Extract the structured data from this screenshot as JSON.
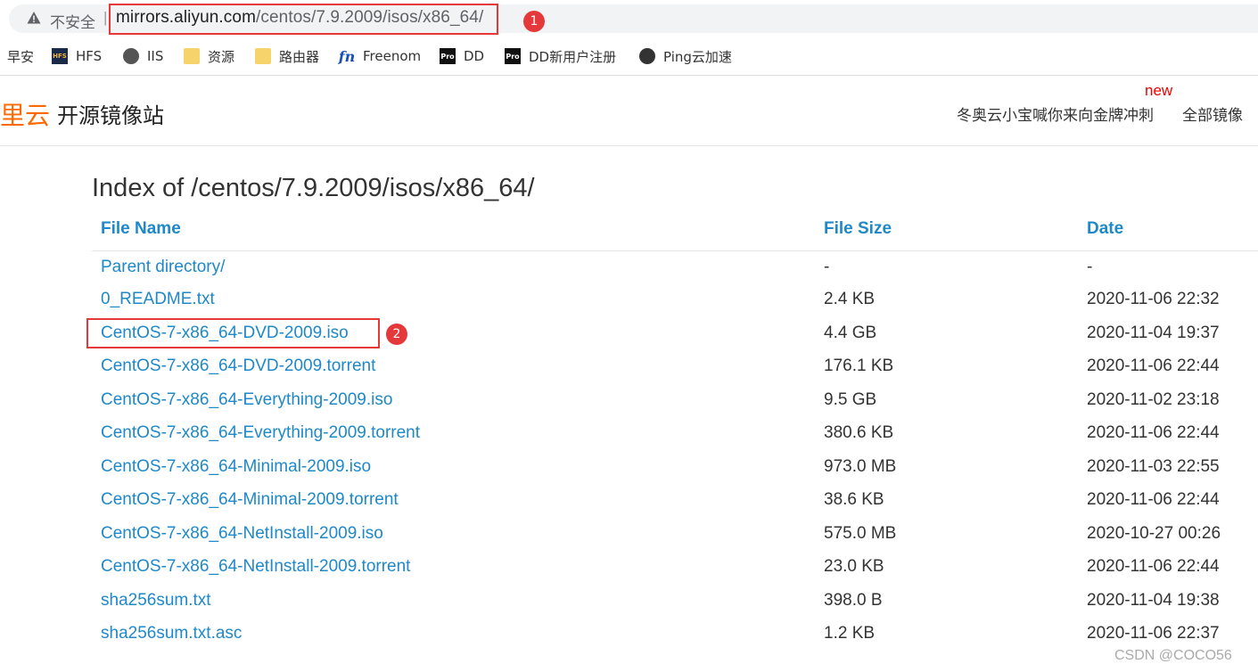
{
  "browser": {
    "security_label": "不安全",
    "separator": "|",
    "url_host": "mirrors.aliyun.com",
    "url_path": "/centos/7.9.2009/isos/x86_64/"
  },
  "annotations": {
    "badge1": "1",
    "badge2": "2",
    "highlight_color": "#e5383b"
  },
  "bookmarks": [
    {
      "label": "早安",
      "icon": "none"
    },
    {
      "label": "HFS",
      "icon": "hfs-icon"
    },
    {
      "label": "IIS",
      "icon": "globe-icon"
    },
    {
      "label": "资源",
      "icon": "folder-icon"
    },
    {
      "label": "路由器",
      "icon": "folder-icon"
    },
    {
      "label": "Freenom",
      "icon": "freenom-icon"
    },
    {
      "label": "DD",
      "icon": "pro-icon"
    },
    {
      "label": "DD新用户注册",
      "icon": "pro-icon"
    },
    {
      "label": "Ping云加速",
      "icon": "ping-icon"
    }
  ],
  "icon_text": {
    "hfs": "HFS",
    "pro": "Pro",
    "fn": "fn"
  },
  "site": {
    "logo_text": "里云",
    "title": "开源镜像站",
    "new_badge": "new",
    "promo_link": "冬奥云小宝喊你来向金牌冲刺",
    "all_mirrors": "全部镜像",
    "brand_color": "#ff6a00",
    "link_color": "#1e88c8"
  },
  "index": {
    "title": "Index of /centos/7.9.2009/isos/x86_64/",
    "headers": {
      "name": "File Name",
      "size": "File Size",
      "date": "Date"
    },
    "rows": [
      {
        "name": "Parent directory/",
        "size": "-",
        "date": "-"
      },
      {
        "name": "0_README.txt",
        "size": "2.4 KB",
        "date": "2020-11-06 22:32"
      },
      {
        "name": "CentOS-7-x86_64-DVD-2009.iso",
        "size": "4.4 GB",
        "date": "2020-11-04 19:37"
      },
      {
        "name": "CentOS-7-x86_64-DVD-2009.torrent",
        "size": "176.1 KB",
        "date": "2020-11-06 22:44"
      },
      {
        "name": "CentOS-7-x86_64-Everything-2009.iso",
        "size": "9.5 GB",
        "date": "2020-11-02 23:18"
      },
      {
        "name": "CentOS-7-x86_64-Everything-2009.torrent",
        "size": "380.6 KB",
        "date": "2020-11-06 22:44"
      },
      {
        "name": "CentOS-7-x86_64-Minimal-2009.iso",
        "size": "973.0 MB",
        "date": "2020-11-03 22:55"
      },
      {
        "name": "CentOS-7-x86_64-Minimal-2009.torrent",
        "size": "38.6 KB",
        "date": "2020-11-06 22:44"
      },
      {
        "name": "CentOS-7-x86_64-NetInstall-2009.iso",
        "size": "575.0 MB",
        "date": "2020-10-27 00:26"
      },
      {
        "name": "CentOS-7-x86_64-NetInstall-2009.torrent",
        "size": "23.0 KB",
        "date": "2020-11-06 22:44"
      },
      {
        "name": "sha256sum.txt",
        "size": "398.0 B",
        "date": "2020-11-04 19:38"
      },
      {
        "name": "sha256sum.txt.asc",
        "size": "1.2 KB",
        "date": "2020-11-06 22:37"
      }
    ]
  },
  "watermark": "CSDN @COCO56"
}
